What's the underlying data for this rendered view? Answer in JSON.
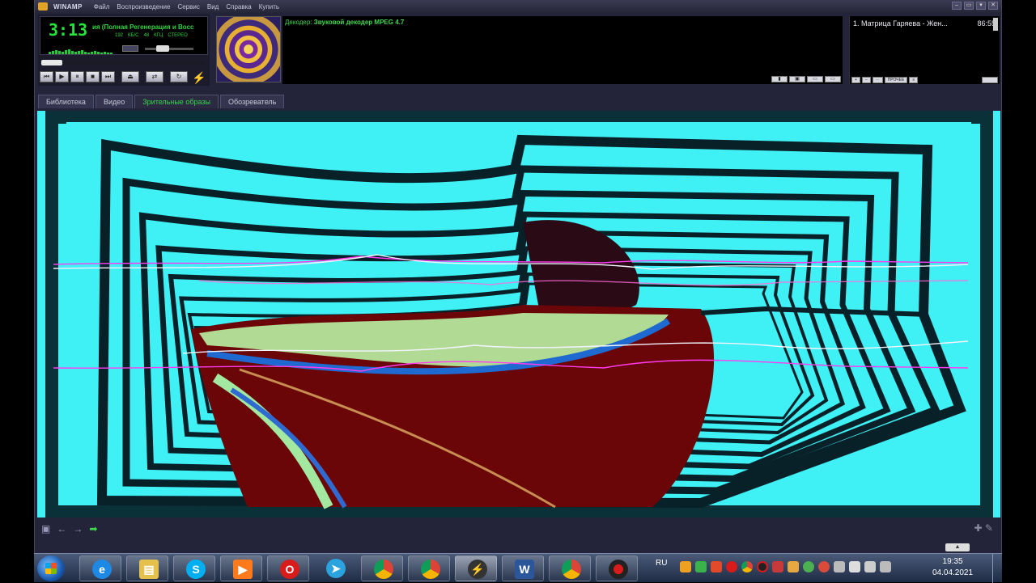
{
  "window": {
    "app_name": "WINAMP",
    "menu": [
      "Файл",
      "Воспроизведение",
      "Сервис",
      "Вид",
      "Справка",
      "Купить"
    ]
  },
  "player": {
    "time": "3:13",
    "song_title": "ия (Полная Регенерация и Восс",
    "bitrate": "192",
    "bitrate_unit": "КБ/С",
    "samplerate": "48",
    "samplerate_unit": "КГЦ",
    "channels": "СТЕРЕО",
    "volume_level": 0.45,
    "seek_position": 0.12
  },
  "info": {
    "decoder_label": "Декодер:",
    "decoder_value": "Звуковой декодер MPEG 4.7"
  },
  "playlist": {
    "items": [
      {
        "title": "1. Матрица Гаряева - Жен...",
        "duration": "86:55"
      }
    ],
    "buttons": [
      "+",
      "–",
      "···",
      "ПРОЧЕЕ",
      "≡"
    ]
  },
  "tabs": [
    {
      "label": "Библиотека",
      "active": false
    },
    {
      "label": "Видео",
      "active": false
    },
    {
      "label": "Зрительные образы",
      "active": true
    },
    {
      "label": "Обозреватель",
      "active": false
    }
  ],
  "taskbar": {
    "language": "RU",
    "time": "19:35",
    "date": "04.04.2021",
    "apps": [
      "ie-icon",
      "explorer-icon",
      "skype-icon",
      "media-icon",
      "opera-icon",
      "telegram-icon",
      "chrome-icon",
      "chrome-icon",
      "winamp-icon",
      "word-icon",
      "chrome-icon",
      "recorder-icon"
    ]
  },
  "colors": {
    "vis_background": "#3ff0f4",
    "lcd_text": "#27e33a",
    "accent_green": "#36d64a"
  }
}
